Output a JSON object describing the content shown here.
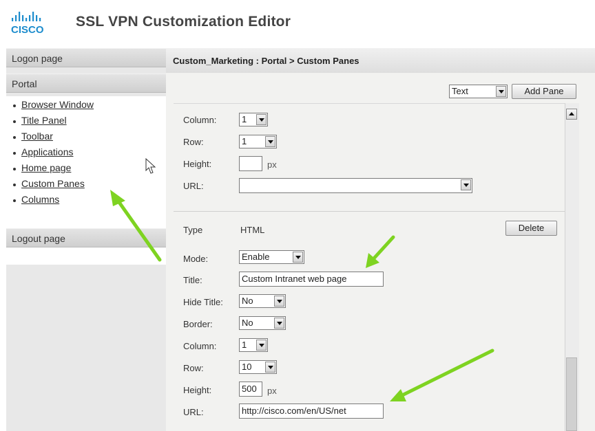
{
  "app": {
    "logo_text": "CISCO",
    "title": "SSL VPN Customization Editor"
  },
  "leftnav": {
    "logon": "Logon page",
    "portal": "Portal",
    "logout": "Logout page",
    "items": [
      {
        "label": "Browser Window"
      },
      {
        "label": "Title Panel"
      },
      {
        "label": "Toolbar"
      },
      {
        "label": "Applications"
      },
      {
        "label": "Home page"
      },
      {
        "label": "Custom Panes"
      },
      {
        "label": "Columns"
      }
    ]
  },
  "main": {
    "breadcrumb": "Custom_Marketing : Portal > Custom Panes",
    "pane_type_select": "Text",
    "add_pane": "Add Pane",
    "pane1": {
      "column_label": "Column:",
      "column_value": "1",
      "row_label": "Row:",
      "row_value": "1",
      "height_label": "Height:",
      "height_value": "",
      "height_unit": "px",
      "url_label": "URL:",
      "url_value": ""
    },
    "pane2": {
      "type_label": "Type",
      "type_value": "HTML",
      "delete": "Delete",
      "mode_label": "Mode:",
      "mode_value": "Enable",
      "title_label": "Title:",
      "title_value": "Custom Intranet web page",
      "hide_title_label": "Hide Title:",
      "hide_title_value": "No",
      "border_label": "Border:",
      "border_value": "No",
      "column_label": "Column:",
      "column_value": "1",
      "row_label": "Row:",
      "row_value": "10",
      "height_label": "Height:",
      "height_value": "500",
      "height_unit": "px",
      "url_label": "URL:",
      "url_value": "http://cisco.com/en/US/net"
    }
  },
  "colors": {
    "annotation_arrow": "#7ed321",
    "nav_bg": "#e8e8e8",
    "content_bg": "#f2f2f0"
  }
}
